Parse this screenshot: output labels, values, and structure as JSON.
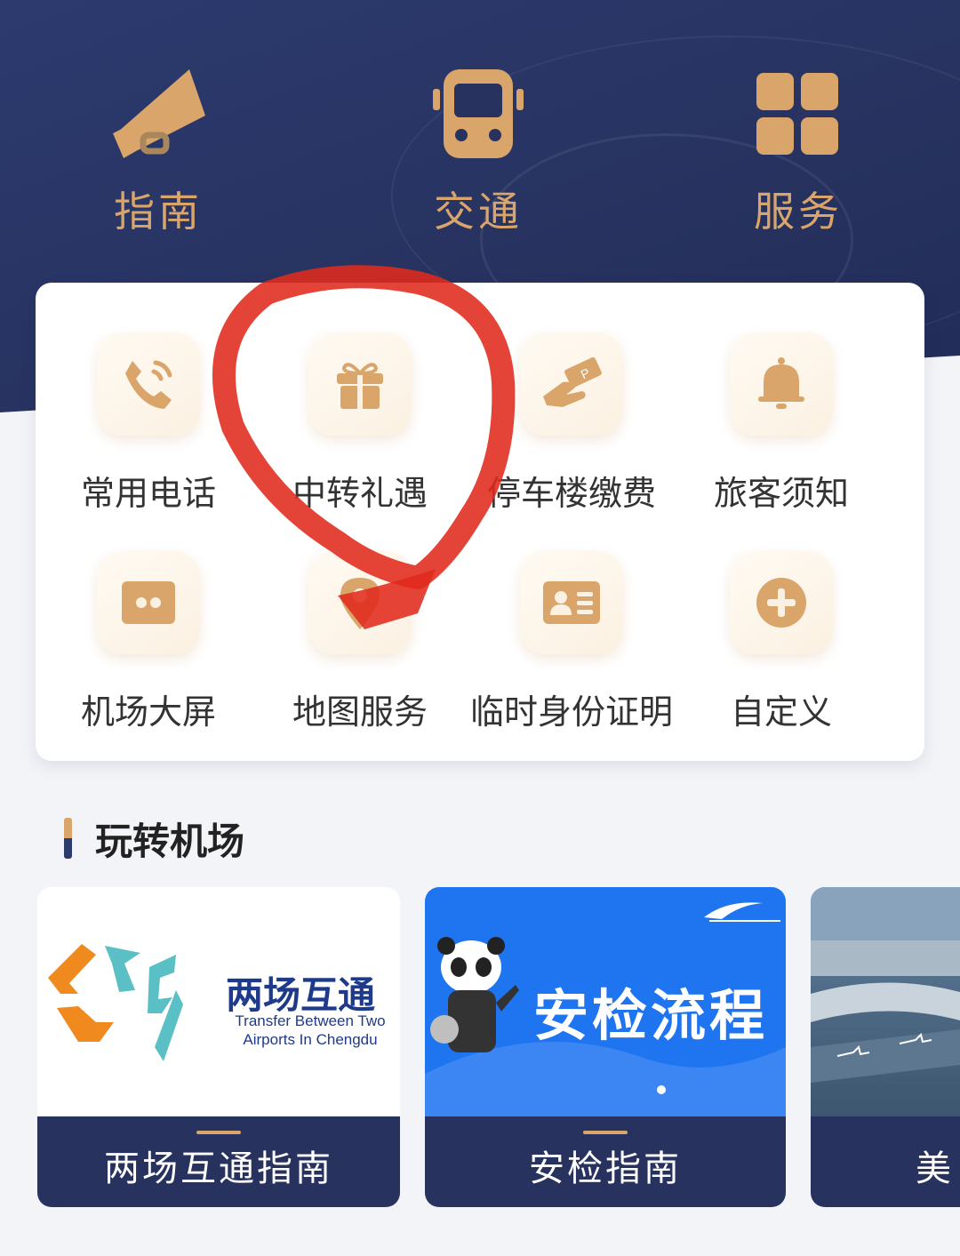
{
  "top_nav": [
    {
      "label": "指南",
      "icon": "megaphone-icon"
    },
    {
      "label": "交通",
      "icon": "bus-icon"
    },
    {
      "label": "服务",
      "icon": "grid-icon"
    }
  ],
  "services": [
    {
      "label": "常用电话",
      "icon": "phone-icon"
    },
    {
      "label": "中转礼遇",
      "icon": "gift-icon"
    },
    {
      "label": "停车楼缴费",
      "icon": "parking-ticket-icon"
    },
    {
      "label": "旅客须知",
      "icon": "bell-icon"
    },
    {
      "label": "机场大屏",
      "icon": "screen-icon"
    },
    {
      "label": "地图服务",
      "icon": "map-pin-icon"
    },
    {
      "label": "临时身份证明",
      "icon": "id-card-icon"
    },
    {
      "label": "自定义",
      "icon": "plus-icon"
    }
  ],
  "section": {
    "title": "玩转机场"
  },
  "promos": [
    {
      "image_title": "两场互通",
      "image_subtitle": "Transfer Between Two Airports In Chengdu",
      "label": "两场互通指南"
    },
    {
      "image_title": "安检流程",
      "label": "安检指南"
    },
    {
      "label": "美"
    }
  ],
  "colors": {
    "navy": "#27325f",
    "gold": "#d9a56a",
    "annotation_red": "#e02a1c"
  }
}
